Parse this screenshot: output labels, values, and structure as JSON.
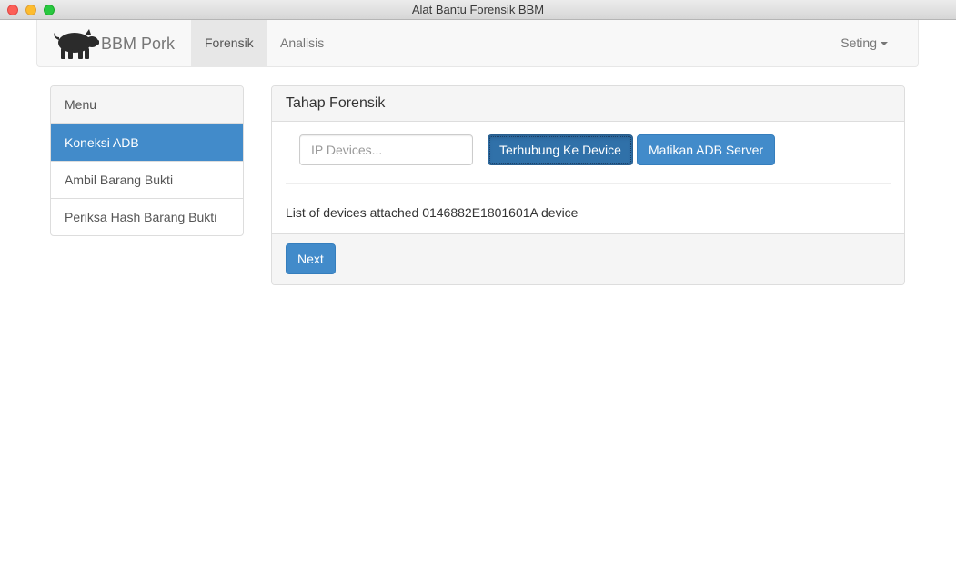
{
  "window": {
    "title": "Alat Bantu Forensik BBM"
  },
  "navbar": {
    "brand": "BBM Pork",
    "brand_icon": "pig-icon",
    "tabs": [
      {
        "label": "Forensik",
        "active": true
      },
      {
        "label": "Analisis",
        "active": false
      }
    ],
    "settings_label": "Seting"
  },
  "sidebar": {
    "heading": "Menu",
    "items": [
      {
        "label": "Koneksi ADB",
        "active": true
      },
      {
        "label": "Ambil Barang Bukti",
        "active": false
      },
      {
        "label": "Periksa Hash Barang Bukti",
        "active": false
      }
    ]
  },
  "panel": {
    "heading": "Tahap Forensik",
    "ip_input": {
      "placeholder": "IP Devices...",
      "value": ""
    },
    "connect_button": "Terhubung Ke Device",
    "kill_button": "Matikan ADB Server",
    "output": "List of devices attached 0146882E1801601A device",
    "next_button": "Next"
  },
  "colors": {
    "primary": "#428bca",
    "primary_active": "#3071a9",
    "navbar_bg": "#f8f8f8"
  }
}
